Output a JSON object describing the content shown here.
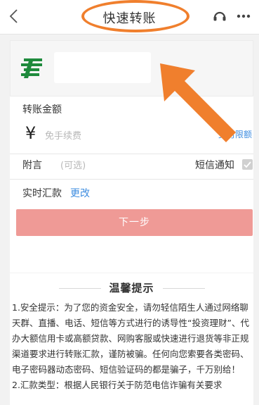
{
  "header": {
    "title": "快速转账",
    "back_icon": "chevron-left-icon",
    "service_icon": "customer-service-icon",
    "more_icon": "more-dots-icon",
    "annotation_color": "#f07f2d"
  },
  "account": {
    "bank_logo_icon": "postal-savings-bank-logo",
    "logo_color": "#1e8a3c"
  },
  "form": {
    "amount_label": "转账金额",
    "currency_symbol": "¥",
    "amount_placeholder": "免手续费",
    "limit_link": "支付限额",
    "memo_label": "附言",
    "memo_placeholder": "(可选)",
    "sms_label": "短信通知",
    "sms_checked": false,
    "mode_label": "实时汇款",
    "mode_change_link": "更改",
    "next_button": "下一步",
    "next_button_color": "#ef9a96",
    "link_color": "#3e8de0"
  },
  "tips": {
    "title": "温馨提示",
    "items": [
      "1.安全提示：为了您的资金安全，请勿轻信陌生人通过网络聊天群、直播、电话、短信等方式进行的诱导性“投资理财”、代办大额信用卡或高额贷款、网购客服或快速进行退货等非正规渠道要求进行转账汇款，谨防被骗。任何向您索要各类密码、电子密码器动态密码、短信验证码的都是骗子，千万别给！",
      "2.汇款类型：根据人民银行关于防范电信诈骗有关要求"
    ]
  }
}
